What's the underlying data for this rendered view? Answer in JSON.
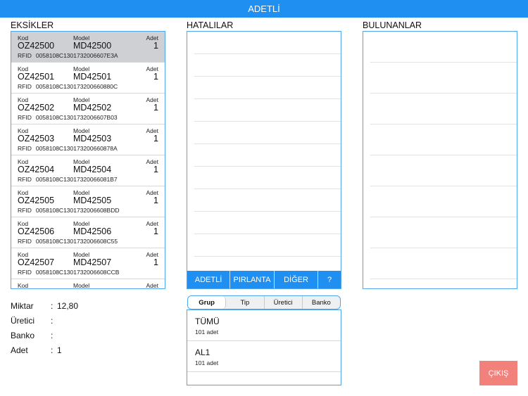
{
  "header": {
    "title": "ADETLİ"
  },
  "sections": {
    "missing": "EKSİKLER",
    "faulty": "HATALILAR",
    "found": "BULUNANLAR"
  },
  "labels": {
    "kod": "Kod",
    "model": "Model",
    "adet": "Adet",
    "rfid": "RFID"
  },
  "missing_items": [
    {
      "kod": "OZ42500",
      "model": "MD42500",
      "adet": "1",
      "rfid": "0058108C1301732006607E3A"
    },
    {
      "kod": "OZ42501",
      "model": "MD42501",
      "adet": "1",
      "rfid": "0058108C130173200660880C"
    },
    {
      "kod": "OZ42502",
      "model": "MD42502",
      "adet": "1",
      "rfid": "0058108C1301732006607B03"
    },
    {
      "kod": "OZ42503",
      "model": "MD42503",
      "adet": "1",
      "rfid": "0058108C130173200660878A"
    },
    {
      "kod": "OZ42504",
      "model": "MD42504",
      "adet": "1",
      "rfid": "0058108C13017320066081B7"
    },
    {
      "kod": "OZ42505",
      "model": "MD42505",
      "adet": "1",
      "rfid": "0058108C1301732006608BDD"
    },
    {
      "kod": "OZ42506",
      "model": "MD42506",
      "adet": "1",
      "rfid": "0058108C1301732006608C55"
    },
    {
      "kod": "OZ42507",
      "model": "MD42507",
      "adet": "1",
      "rfid": "0058108C1301732006608CCB"
    }
  ],
  "category_buttons": [
    "ADETLİ",
    "PIRLANTA",
    "DİĞER",
    "?"
  ],
  "info": [
    {
      "key": "Miktar",
      "value": "12,80"
    },
    {
      "key": "Üretici",
      "value": ""
    },
    {
      "key": "Banko",
      "value": ""
    },
    {
      "key": "Adet",
      "value": "1"
    }
  ],
  "segments": {
    "tabs": [
      "Grup",
      "Tip",
      "Üretici",
      "Banko"
    ],
    "selected": "Grup"
  },
  "groups": [
    {
      "name": "TÜMÜ",
      "count": "101 adet"
    },
    {
      "name": "AL1",
      "count": "101 adet"
    }
  ],
  "exit_button": "ÇIKIŞ",
  "colors": {
    "accent": "#1f8ff2",
    "exit": "#f3817b",
    "selected_row": "#cfd0d4"
  }
}
